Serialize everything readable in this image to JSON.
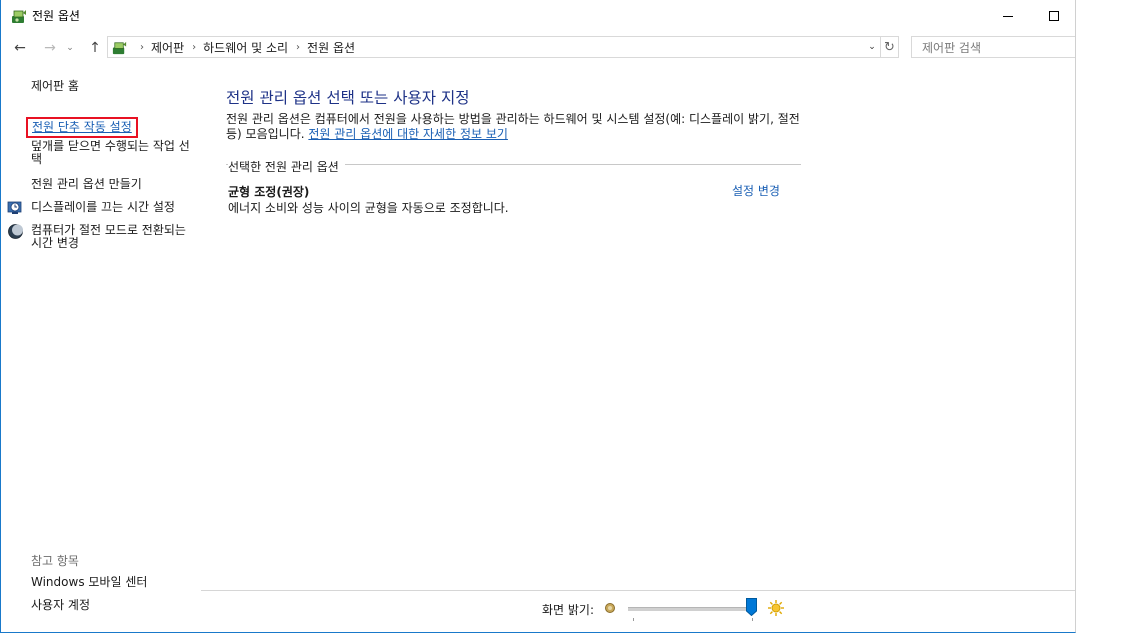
{
  "window": {
    "title": "전원 옵션"
  },
  "nav": {
    "breadcrumbs": [
      "제어판",
      "하드웨어 및 소리",
      "전원 옵션"
    ],
    "search_placeholder": "제어판 검색"
  },
  "sidebar": {
    "home": "제어판 홈",
    "links": [
      "전원 단추 작동 설정",
      "덮개를 닫으면 수행되는 작업 선택",
      "전원 관리 옵션 만들기",
      "디스플레이를 끄는 시간 설정",
      "컴퓨터가 절전 모드로 전환되는 시간 변경"
    ],
    "see_also_title": "참고 항목",
    "see_also": [
      "Windows 모바일 센터",
      "사용자 계정"
    ]
  },
  "main": {
    "heading": "전원 관리 옵션 선택 또는 사용자 지정",
    "description": "전원 관리 옵션은 컴퓨터에서 전원을 사용하는 방법을 관리하는 하드웨어 및 시스템 설정(예: 디스플레이 밝기, 절전 등) 모음입니다.",
    "description_link": "전원 관리 옵션에 대한 자세한 정보 보기",
    "group_title": "선택한 전원 관리 옵션",
    "plan": {
      "name": "균형 조정(권장)",
      "description": "에너지 소비와 성능 사이의 균형을 자동으로 조정합니다.",
      "change_link": "설정 변경"
    }
  },
  "footer": {
    "brightness_label": "화면 밝기:",
    "brightness_level": 1.0
  },
  "colors": {
    "accent_link": "#1a5fb4",
    "heading": "#1e3287",
    "highlight_box": "#e81123",
    "slider_thumb": "#0078d7"
  }
}
